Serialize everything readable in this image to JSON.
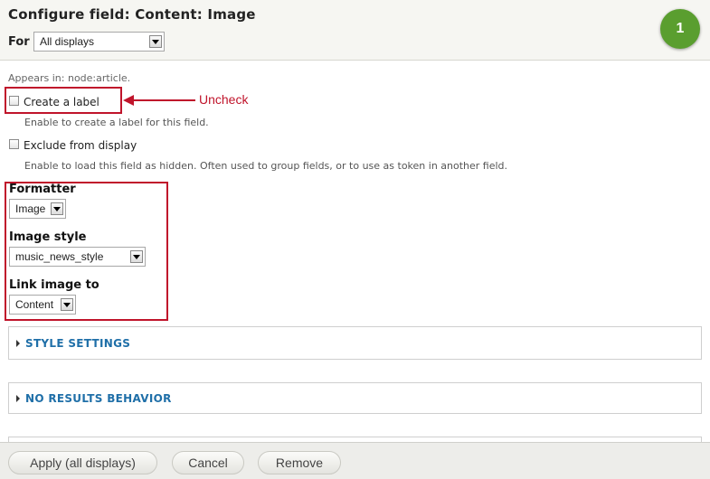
{
  "header": {
    "title": "Configure field: Content: Image",
    "for_label": "For",
    "for_select": "All displays",
    "step_badge": "1"
  },
  "appears_in": "Appears in: node:article.",
  "create_label": {
    "label": "Create a label",
    "description": "Enable to create a label for this field.",
    "checked": false
  },
  "exclude": {
    "label": "Exclude from display",
    "description": "Enable to load this field as hidden. Often used to group fields, or to use as token in another field.",
    "checked": false
  },
  "annotation": {
    "text": "Uncheck",
    "color": "#c0142b"
  },
  "formatter": {
    "label": "Formatter",
    "value": "Image"
  },
  "image_style": {
    "label": "Image style",
    "value": "music_news_style"
  },
  "link_image": {
    "label": "Link image to",
    "value": "Content"
  },
  "sections": {
    "style": "STYLE SETTINGS",
    "no_results": "NO RESULTS BEHAVIOR"
  },
  "buttons": {
    "apply": "Apply (all displays)",
    "cancel": "Cancel",
    "remove": "Remove"
  },
  "colors": {
    "badge": "#5a9e2f",
    "link": "#1f6fa8",
    "highlight": "#c0142b"
  }
}
